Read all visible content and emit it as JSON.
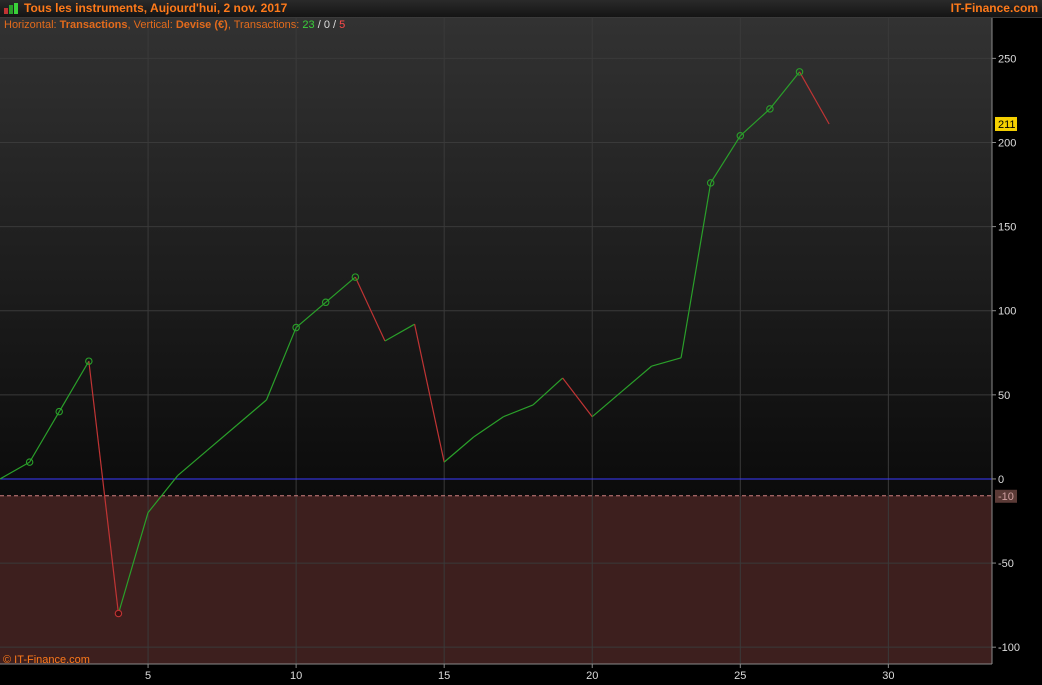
{
  "header": {
    "title": "Tous les instruments, Aujourd'hui, 2 nov. 2017",
    "brand": "IT-Finance.com"
  },
  "info": {
    "horizontal_label": "Horizontal:",
    "horizontal_value": "Transactions",
    "vertical_label": "Vertical:",
    "vertical_value": "Devise (€)",
    "transactions_label": "Transactions:",
    "count_wins": "23",
    "count_neutral": "0",
    "count_losses": "5",
    "sep1": ",",
    "sep2": ",",
    "slash1": "/",
    "slash2": "/"
  },
  "footer": {
    "copyright": "© IT-Finance.com"
  },
  "colors": {
    "up": "#2aa02a",
    "down": "#c03434",
    "zero_line": "#3a3aff",
    "threshold_line": "#d08080",
    "loss_zone": "#3d1f1e",
    "current_badge": "#f5d000",
    "accent": "#ff7a1a"
  },
  "chart_data": {
    "type": "line",
    "xlabel": "Transactions",
    "ylabel": "Devise (€)",
    "xlim": [
      0,
      33.5
    ],
    "ylim": [
      -110,
      274
    ],
    "x_ticks": [
      "5",
      "10",
      "15",
      "20",
      "25",
      "30"
    ],
    "x_tick_values": [
      5,
      10,
      15,
      20,
      25,
      30
    ],
    "y_ticks": [
      "250",
      "200",
      "150",
      "100",
      "50",
      "0",
      "-50",
      "-100"
    ],
    "y_tick_values": [
      250,
      200,
      150,
      100,
      50,
      0,
      -50,
      -100
    ],
    "grid": true,
    "zero_line": 0,
    "threshold": {
      "value": -10,
      "label": "-10"
    },
    "current_value": {
      "value": 211,
      "label": "211"
    },
    "series": [
      {
        "values": [
          {
            "x": 0,
            "y": 0
          },
          {
            "x": 1,
            "y": 10
          },
          {
            "x": 2,
            "y": 40
          },
          {
            "x": 3,
            "y": 70
          },
          {
            "x": 4,
            "y": -80
          },
          {
            "x": 5,
            "y": -20
          },
          {
            "x": 6,
            "y": 2
          },
          {
            "x": 7,
            "y": 17
          },
          {
            "x": 8,
            "y": 32
          },
          {
            "x": 9,
            "y": 47
          },
          {
            "x": 10,
            "y": 90
          },
          {
            "x": 11,
            "y": 105
          },
          {
            "x": 12,
            "y": 120
          },
          {
            "x": 13,
            "y": 82
          },
          {
            "x": 14,
            "y": 92
          },
          {
            "x": 15,
            "y": 10
          },
          {
            "x": 16,
            "y": 25
          },
          {
            "x": 17,
            "y": 37
          },
          {
            "x": 18,
            "y": 44
          },
          {
            "x": 19,
            "y": 60
          },
          {
            "x": 20,
            "y": 37
          },
          {
            "x": 21,
            "y": 52
          },
          {
            "x": 22,
            "y": 67
          },
          {
            "x": 23,
            "y": 72
          },
          {
            "x": 24,
            "y": 176
          },
          {
            "x": 25,
            "y": 204
          },
          {
            "x": 26,
            "y": 220
          },
          {
            "x": 27,
            "y": 242
          },
          {
            "x": 28,
            "y": 211
          }
        ],
        "markers_at": [
          1,
          2,
          3,
          4,
          10,
          11,
          12,
          24,
          25,
          26,
          27
        ]
      }
    ]
  }
}
